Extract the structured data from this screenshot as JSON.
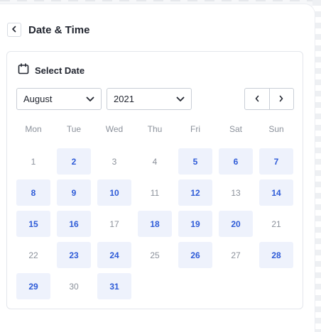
{
  "header": {
    "back_icon": "chevron-left-icon",
    "title": "Date & Time"
  },
  "card": {
    "calendar_icon": "calendar-icon",
    "label": "Select Date"
  },
  "month_select": {
    "value": "August",
    "icon": "chevron-down-icon"
  },
  "year_select": {
    "value": "2021",
    "icon": "chevron-down-icon"
  },
  "nav": {
    "prev_icon": "chevron-left-icon",
    "next_icon": "chevron-right-icon"
  },
  "colors": {
    "accent": "#2e5bd7",
    "available_bg": "#eef2fc",
    "muted_text": "#8b919b"
  },
  "weekdays": [
    "Mon",
    "Tue",
    "Wed",
    "Thu",
    "Fri",
    "Sat",
    "Sun"
  ],
  "days": [
    {
      "label": "1",
      "available": false
    },
    {
      "label": "2",
      "available": true
    },
    {
      "label": "3",
      "available": false
    },
    {
      "label": "4",
      "available": false
    },
    {
      "label": "5",
      "available": true
    },
    {
      "label": "6",
      "available": true
    },
    {
      "label": "7",
      "available": true
    },
    {
      "label": "8",
      "available": true
    },
    {
      "label": "9",
      "available": true
    },
    {
      "label": "10",
      "available": true
    },
    {
      "label": "11",
      "available": false
    },
    {
      "label": "12",
      "available": true
    },
    {
      "label": "13",
      "available": false
    },
    {
      "label": "14",
      "available": true
    },
    {
      "label": "15",
      "available": true
    },
    {
      "label": "16",
      "available": true
    },
    {
      "label": "17",
      "available": false
    },
    {
      "label": "18",
      "available": true
    },
    {
      "label": "19",
      "available": true
    },
    {
      "label": "20",
      "available": true
    },
    {
      "label": "21",
      "available": false
    },
    {
      "label": "22",
      "available": false
    },
    {
      "label": "23",
      "available": true
    },
    {
      "label": "24",
      "available": true
    },
    {
      "label": "25",
      "available": false
    },
    {
      "label": "26",
      "available": true
    },
    {
      "label": "27",
      "available": false
    },
    {
      "label": "28",
      "available": true
    },
    {
      "label": "29",
      "available": true
    },
    {
      "label": "30",
      "available": false
    },
    {
      "label": "31",
      "available": true
    }
  ]
}
